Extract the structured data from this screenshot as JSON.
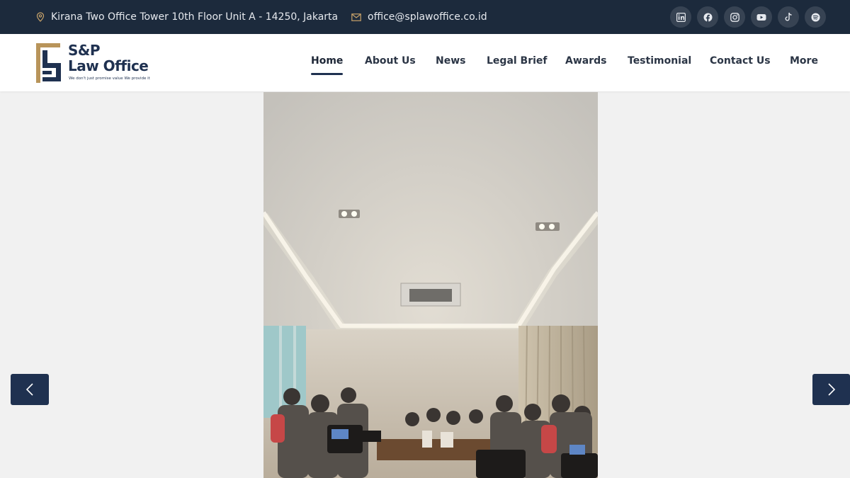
{
  "topbar": {
    "address": "Kirana Two Office Tower 10th Floor Unit A - 14250, Jakarta",
    "email": "office@splawoffice.co.id",
    "social_icons": [
      "linkedin-icon",
      "facebook-icon",
      "instagram-icon",
      "youtube-icon",
      "tiktok-icon",
      "spotify-icon"
    ]
  },
  "brand": {
    "line1": "S&P",
    "line2": "Law Office",
    "tagline": "We don't just promise value We provide it",
    "colors": {
      "navy": "#1f3150",
      "gold": "#b8945a"
    }
  },
  "nav": {
    "home": "Home",
    "about": "About Us",
    "news": "News",
    "legal_brief": "Legal Brief",
    "awards": "Awards",
    "testimonial": "Testimonial",
    "contact": "Contact Us",
    "more": "More",
    "active": "Home"
  },
  "slider": {
    "prev_icon": "chevron-left-icon",
    "next_icon": "chevron-right-icon",
    "image": "press conference in meeting room"
  }
}
